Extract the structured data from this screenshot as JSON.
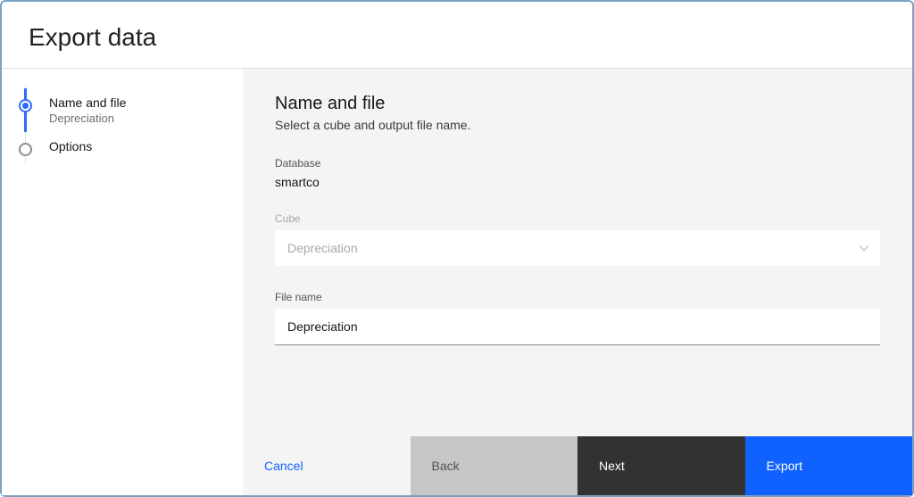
{
  "header": {
    "title": "Export data"
  },
  "sidebar": {
    "steps": [
      {
        "title": "Name and file",
        "subtitle": "Depreciation",
        "active": true
      },
      {
        "title": "Options",
        "subtitle": "",
        "active": false
      }
    ]
  },
  "main": {
    "heading": "Name and file",
    "subheading": "Select a cube and output file name.",
    "database": {
      "label": "Database",
      "value": "smartco"
    },
    "cube": {
      "label": "Cube",
      "value": "Depreciation"
    },
    "filename": {
      "label": "File name",
      "value": "Depreciation"
    }
  },
  "footer": {
    "cancel": "Cancel",
    "back": "Back",
    "next": "Next",
    "export": "Export"
  }
}
